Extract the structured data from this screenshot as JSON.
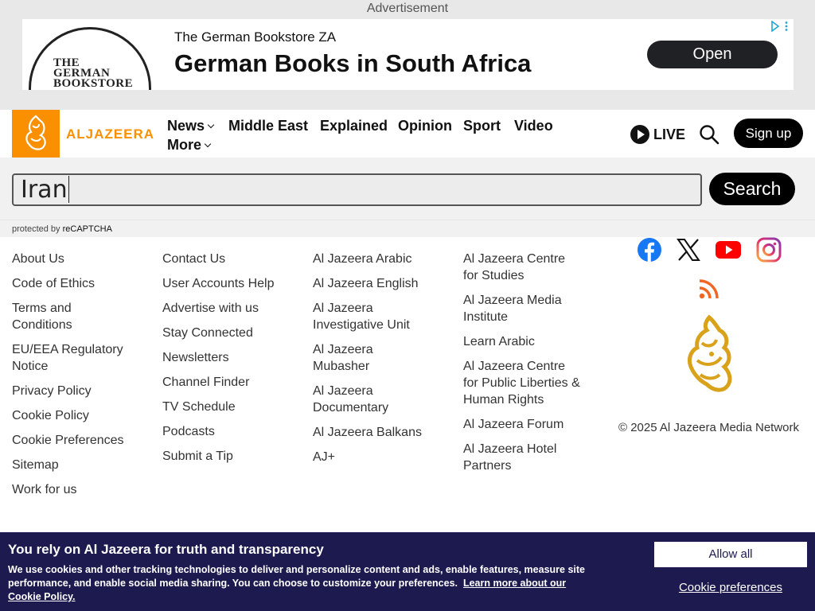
{
  "ad": {
    "label": "Advertisement",
    "logo_text": "THE GERMAN BOOKSTORE",
    "small_title": "The German Bookstore ZA",
    "headline": "German Books in South Africa",
    "cta": "Open"
  },
  "header": {
    "logo_word": "ALJAZEERA",
    "nav": [
      "News",
      "Middle East",
      "Explained",
      "Opinion",
      "Sport",
      "Video",
      "More"
    ],
    "live": "LIVE",
    "signup": "Sign up"
  },
  "search": {
    "value": "Iran",
    "button": "Search",
    "recaptcha_prefix": "protected by",
    "recaptcha_brand": "reCAPTCHA"
  },
  "footer": {
    "col1": [
      "About Us",
      "Code of Ethics",
      "Terms and Conditions",
      "EU/EEA Regulatory Notice",
      "Privacy Policy",
      "Cookie Policy",
      "Cookie Preferences",
      "Sitemap",
      "Work for us"
    ],
    "col2": [
      "Contact Us",
      "User Accounts Help",
      "Advertise with us",
      "Stay Connected",
      "Newsletters",
      "Channel Finder",
      "TV Schedule",
      "Podcasts",
      "Submit a Tip"
    ],
    "col3": [
      "Al Jazeera Arabic",
      "Al Jazeera English",
      "Al Jazeera Investigative Unit",
      "Al Jazeera Mubasher",
      "Al Jazeera Documentary",
      "Al Jazeera Balkans",
      "AJ+"
    ],
    "col4": [
      "Al Jazeera Centre for Studies",
      "Al Jazeera Media Institute",
      "Learn Arabic",
      "Al Jazeera Centre for Public Liberties & Human Rights",
      "Al Jazeera Forum",
      "Al Jazeera Hotel Partners"
    ],
    "social_icons": [
      "facebook-icon",
      "x-icon",
      "youtube-icon",
      "instagram-icon",
      "rss-icon"
    ],
    "copyright": "© 2025 Al Jazeera Media Network"
  },
  "cookie": {
    "title": "You rely on Al Jazeera for truth and transparency",
    "text": "We use cookies and other tracking technologies to deliver and personalize content and ads, enable features, measure site performance, and enable social media sharing. You can choose to customize your preferences.",
    "link": "Learn more about our Cookie Policy.",
    "allow": "Allow all",
    "prefs": "Cookie preferences"
  },
  "colors": {
    "brand_orange": "#fa9000",
    "cookie_bg": "#1c1a4f",
    "facebook": "#1877f2",
    "youtube": "#ff0000",
    "rss": "#f26522",
    "gold": "#d9a21b"
  }
}
